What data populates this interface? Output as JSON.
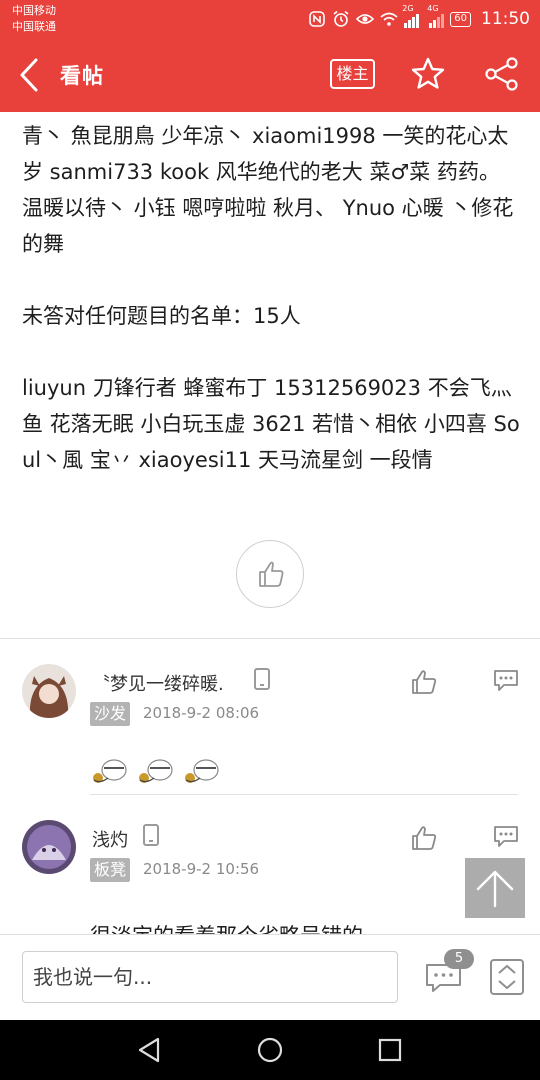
{
  "status_bar": {
    "carrier_1": "中国移动",
    "carrier_2": "中国联通",
    "network_1": "2G",
    "network_2": "4G",
    "battery": "60",
    "time": "11:50"
  },
  "header": {
    "title": "看帖",
    "owner_only_label": "楼主"
  },
  "post": {
    "paragraph_top": "青丶  魚昆朋鳥  少年凉丶  xiaomi1998  一笑的花心太岁  sanmi733  kook  风华绝代的老大  菜♂菜  药药。  温暖以待丶  小钰  嗯哼啦啦  秋月、  Ynuo  心暖  丶修花的舞",
    "paragraph_heading": "未答对任何题目的名单：15人",
    "paragraph_list": "liuyun  刀锋行者  蜂蜜布丁  15312569023  不会飞灬鱼  花落无眠  小白玩玉虚  3621  若惜丶相依  小四喜  Soul丶風  宝丷  xiaoyesi11  天马流星剑  一段情"
  },
  "comments": [
    {
      "name": "〝梦见一缕碎暖.",
      "floor": "沙发",
      "time": "2018-9-2 08:06",
      "content_type": "emoji"
    },
    {
      "name": "浅灼",
      "floor": "板凳",
      "time": "2018-9-2 10:56",
      "text": "很淡定的看着那个省略号错的"
    }
  ],
  "bottom_bar": {
    "input_placeholder": "我也说一句...",
    "comment_count": "5"
  },
  "colors": {
    "brand_red": "#e8403b",
    "badge_gray": "#b3b3b3"
  }
}
